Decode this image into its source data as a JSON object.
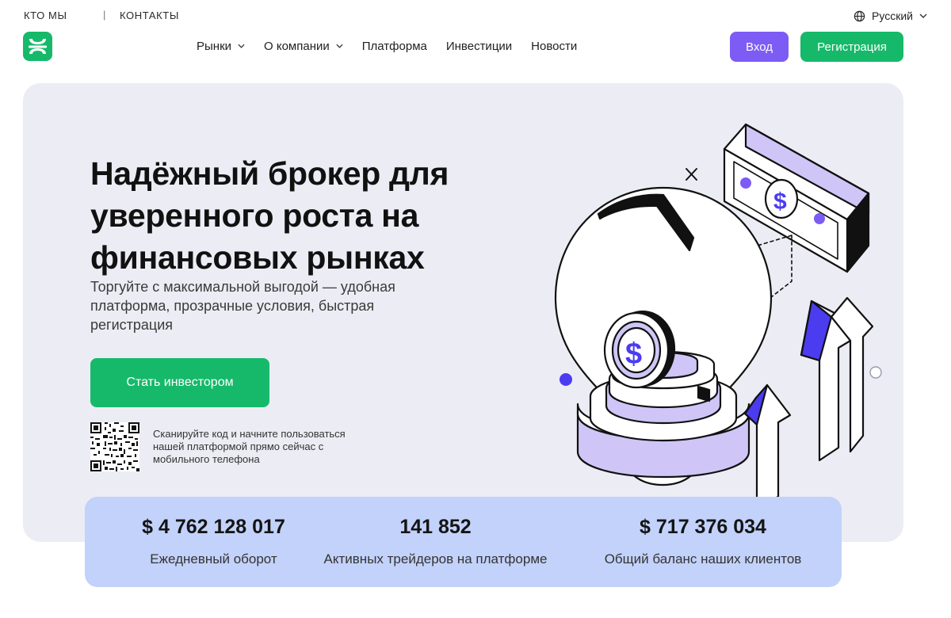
{
  "topbar": {
    "about_label": "КТО МЫ",
    "separator": "|",
    "contacts_label": "КОНТАКТЫ",
    "language_label": "Русский",
    "language_icon": "globe-icon"
  },
  "header": {
    "nav": [
      {
        "label": "Рынки",
        "has_dropdown": true
      },
      {
        "label": "О компании",
        "has_dropdown": true
      },
      {
        "label": "Платформа",
        "has_dropdown": false
      },
      {
        "label": "Инвестиции",
        "has_dropdown": false
      },
      {
        "label": "Новости",
        "has_dropdown": false
      }
    ],
    "login_label": "Вход",
    "register_label": "Регистрация"
  },
  "hero": {
    "title": "Надёжный брокер для уверенного роста на финансовых рынках",
    "subtitle": "Торгуйте с максимальной выгодой — удобная платформа, прозрачные условия, быстрая регистрация",
    "cta_label": "Стать инвестором",
    "qr_caption": "Сканируйте код и начните пользоваться нашей платформой прямо сейчас с мобильного телефона",
    "illustration_icon": "piggy-bulb-dollar-illustration"
  },
  "stats": [
    {
      "value": "$ 4 762 128 017",
      "label": "Ежедневный оборот"
    },
    {
      "value": "141 852",
      "label": "Активных трейдеров на платформе"
    },
    {
      "value": "$ 717 376 034",
      "label": "Общий баланс наших клиентов"
    }
  ],
  "colors": {
    "brand_green": "#16b96a",
    "accent_purple": "#7d5cf5",
    "hero_background": "#ececf4",
    "stats_background": "#c2d2fa",
    "illustration_blue": "#4b3cf0",
    "illustration_lavender": "#cfc6f7"
  }
}
